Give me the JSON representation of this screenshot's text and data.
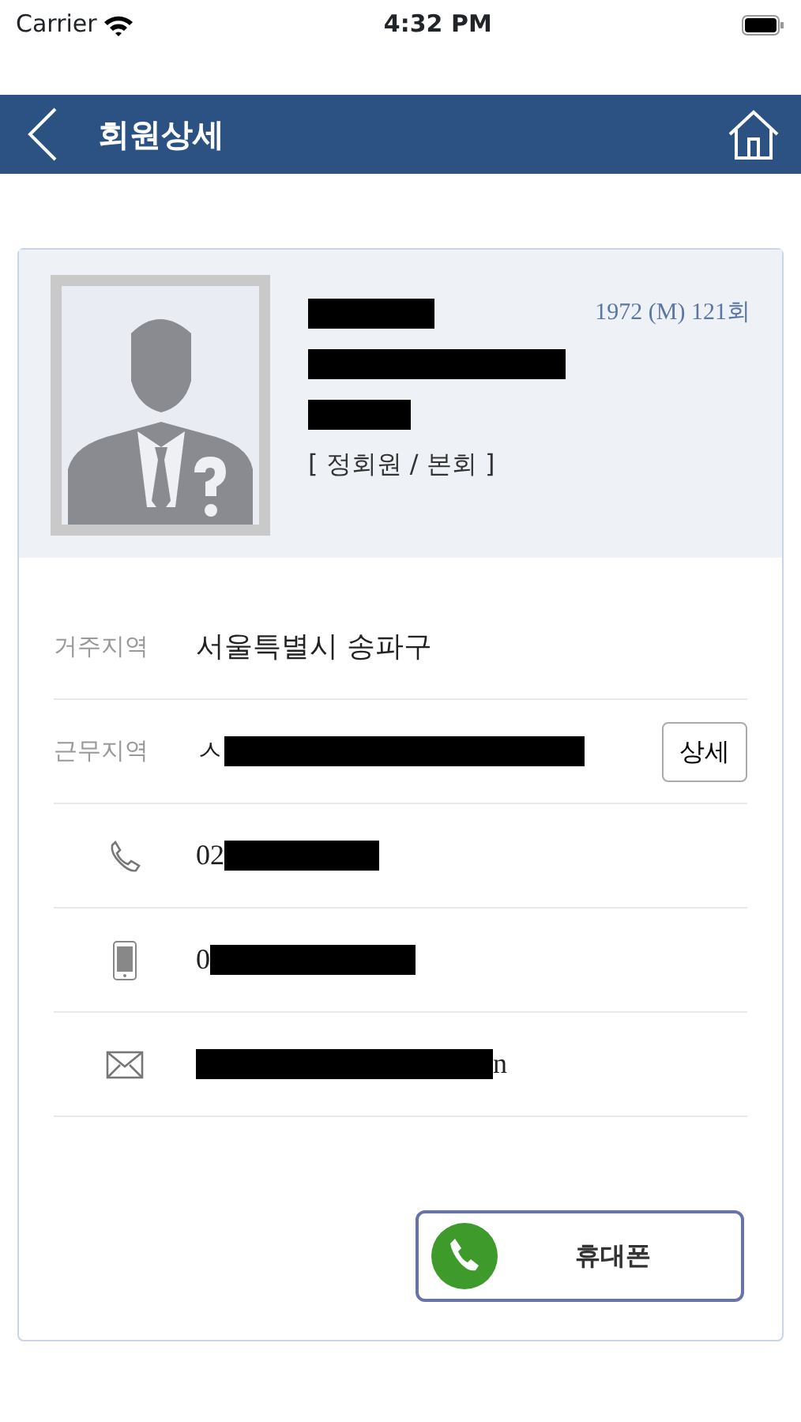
{
  "status_bar": {
    "carrier": "Carrier",
    "time": "4:32 PM"
  },
  "header": {
    "title": "회원상세"
  },
  "profile": {
    "meta": "1972 (M) 121회",
    "lines": [
      {
        "redacted": true
      },
      {
        "redacted": true
      },
      {
        "redacted": true
      },
      {
        "text": "[ 정회원 / 본회 ]",
        "redacted": false
      }
    ]
  },
  "info_rows": [
    {
      "kind": "label",
      "label": "거주지역",
      "value": "서울특별시 송파구",
      "redacted": false
    },
    {
      "kind": "label",
      "label": "근무지역",
      "value": "ㅅ",
      "redacted": true,
      "button": "상세"
    },
    {
      "kind": "phone",
      "value": "02",
      "redacted": true
    },
    {
      "kind": "mobile",
      "value": "0",
      "redacted": true
    },
    {
      "kind": "email",
      "value_after": "n",
      "redacted": true
    }
  ],
  "call_button": {
    "label": "휴대폰"
  }
}
